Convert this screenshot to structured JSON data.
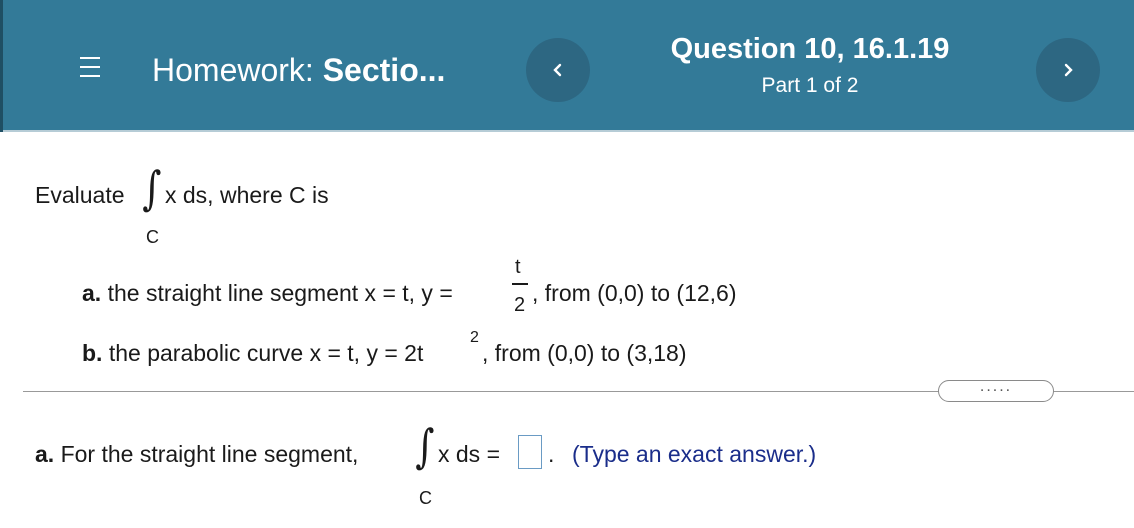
{
  "header": {
    "menu_icon": "hamburger-menu-icon",
    "homework_prefix": "Homework: ",
    "homework_name": "Sectio...",
    "prev_icon": "chevron-left-icon",
    "next_icon": "chevron-right-icon",
    "question_title": "Question 10, 16.1.19",
    "part": "Part 1 of 2",
    "colors": {
      "background": "#337a98",
      "button": "#2d6782"
    }
  },
  "problem": {
    "evaluate": "Evaluate",
    "integrand": "x ds, where C is",
    "integral_sub": "C",
    "a_label": "a.",
    "a_text": "the straight line segment x = t, y =",
    "a_frac_num": "t",
    "a_frac_den": "2",
    "a_rest": ", from (0,0) to (12,6)",
    "b_label": "b.",
    "b_text": "the parabolic curve x = t, y = 2t",
    "b_exp": "2",
    "b_rest": ", from (0,0) to (3,18)"
  },
  "more_button": ".....",
  "answer": {
    "label": "a.",
    "text": "For the straight line segment,",
    "integrand": "x ds =",
    "integral_sub": "C",
    "value": "",
    "period": ".",
    "hint": "(Type an exact answer.)"
  }
}
